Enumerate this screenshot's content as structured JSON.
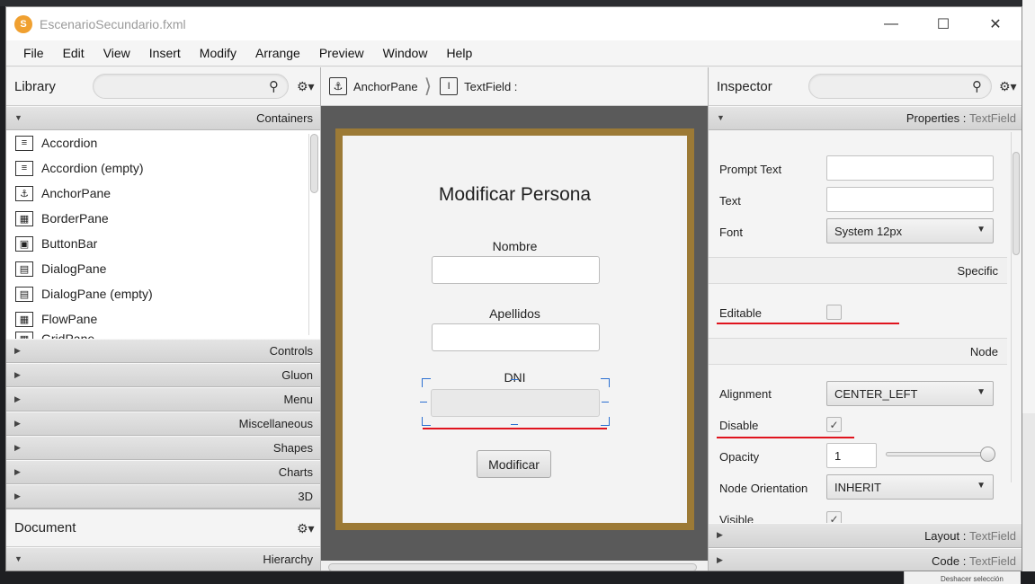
{
  "window": {
    "title": "EscenarioSecundario.fxml"
  },
  "menu": [
    "File",
    "Edit",
    "View",
    "Insert",
    "Modify",
    "Arrange",
    "Preview",
    "Window",
    "Help"
  ],
  "library": {
    "title": "Library",
    "section_open": "Containers",
    "items": [
      "Accordion",
      "Accordion  (empty)",
      "AnchorPane",
      "BorderPane",
      "ButtonBar",
      "DialogPane",
      "DialogPane  (empty)",
      "FlowPane",
      "GridPane"
    ],
    "sections": [
      "Controls",
      "Gluon",
      "Menu",
      "Miscellaneous",
      "Shapes",
      "Charts",
      "3D"
    ]
  },
  "document": {
    "title": "Document",
    "section": "Hierarchy"
  },
  "breadcrumb": {
    "first": "AnchorPane",
    "second": "TextField :"
  },
  "form": {
    "title": "Modificar Persona",
    "label_nombre": "Nombre",
    "label_apellidos": "Apellidos",
    "label_dni": "DNI",
    "button": "Modificar"
  },
  "inspector": {
    "title": "Inspector",
    "properties_head": "Properties",
    "properties_sub": "TextField",
    "prompt_text_label": "Prompt Text",
    "text_label": "Text",
    "font_label": "Font",
    "font_value": "System 12px",
    "specific_head": "Specific",
    "editable_label": "Editable",
    "node_head": "Node",
    "alignment_label": "Alignment",
    "alignment_value": "CENTER_LEFT",
    "disable_label": "Disable",
    "disable_checked": "✓",
    "opacity_label": "Opacity",
    "opacity_value": "1",
    "node_orientation_label": "Node Orientation",
    "node_orientation_value": "INHERIT",
    "visible_label": "Visible",
    "visible_checked": "✓",
    "layout_head": "Layout",
    "layout_sub": "TextField",
    "code_head": "Code",
    "code_sub": "TextField"
  },
  "background": {
    "bottom_menu_text": "Deshacer selección"
  },
  "colors": {
    "accent_red": "#e0141e",
    "selection_blue": "#2b6fd1",
    "frame_brown": "#9c7a36"
  }
}
